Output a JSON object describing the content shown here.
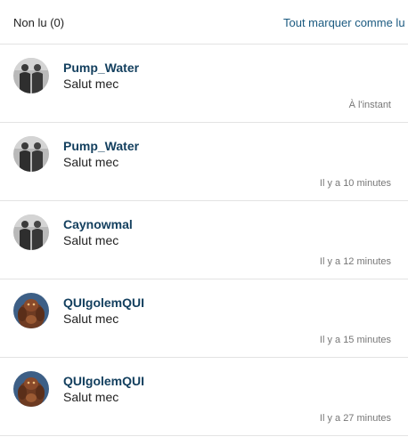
{
  "header": {
    "unread_label": "Non lu (0)",
    "mark_all_label": "Tout marquer comme lu"
  },
  "notifications": [
    {
      "username": "Pump_Water",
      "message": "Salut mec",
      "time": "À l'instant",
      "avatar": "grey-figures-avatar"
    },
    {
      "username": "Pump_Water",
      "message": "Salut mec",
      "time": "Il y a 10 minutes",
      "avatar": "grey-figures-avatar"
    },
    {
      "username": "Caynowmal",
      "message": "Salut mec",
      "time": "Il y a 12 minutes",
      "avatar": "grey-figures-avatar"
    },
    {
      "username": "QUIgolemQUI",
      "message": "Salut mec",
      "time": "Il y a 15 minutes",
      "avatar": "brown-creature-avatar"
    },
    {
      "username": "QUIgolemQUI",
      "message": "Salut mec",
      "time": "Il y a 27 minutes",
      "avatar": "brown-creature-avatar"
    }
  ]
}
